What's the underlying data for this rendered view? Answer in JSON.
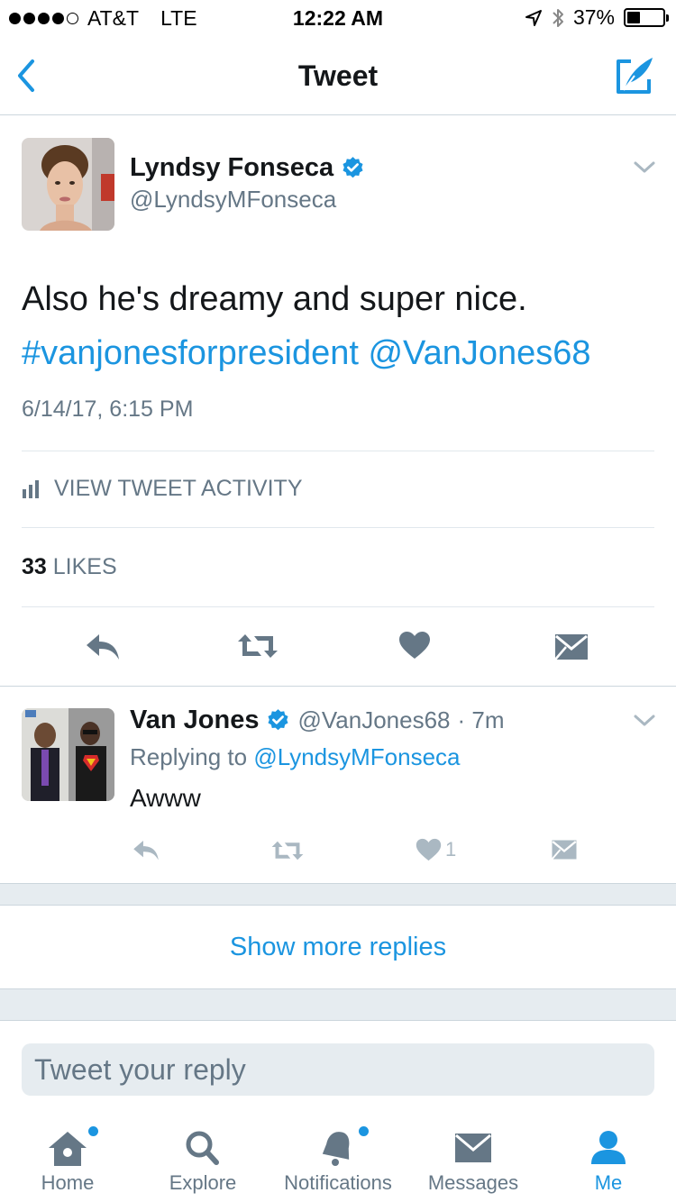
{
  "status_bar": {
    "carrier": "AT&T",
    "network": "LTE",
    "time": "12:22 AM",
    "battery_percent": "37%",
    "battery_level": 0.37
  },
  "nav": {
    "title": "Tweet"
  },
  "main_tweet": {
    "author_name": "Lyndsy Fonseca",
    "author_handle": "@LyndsyMFonseca",
    "text_plain": "Also he's dreamy and super nice.",
    "hashtag": "#vanjonesforpresident",
    "mention": "@VanJones68",
    "timestamp": "6/14/17, 6:15 PM",
    "activity_label": "VIEW TWEET ACTIVITY",
    "likes_count": "33",
    "likes_label": "LIKES"
  },
  "reply_tweet": {
    "author_name": "Van Jones",
    "author_handle": "@VanJones68",
    "time_ago": "· 7m",
    "replying_prefix": "Replying to",
    "replying_to": "@LyndsyMFonseca",
    "text": "Awww",
    "like_count": "1"
  },
  "show_more": "Show more replies",
  "reply_box": {
    "placeholder": "Tweet your reply"
  },
  "tabs": [
    {
      "label": "Home",
      "icon": "home-icon"
    },
    {
      "label": "Explore",
      "icon": "search-icon"
    },
    {
      "label": "Notifications",
      "icon": "bell-icon"
    },
    {
      "label": "Messages",
      "icon": "envelope-icon"
    },
    {
      "label": "Me",
      "icon": "person-icon"
    }
  ],
  "colors": {
    "accent": "#1b95e0",
    "secondary_text": "#657786",
    "divider": "#e1e8ed",
    "band": "#e6ecf0",
    "action_icon": "#657786",
    "action_icon_light": "#aab8c2"
  }
}
